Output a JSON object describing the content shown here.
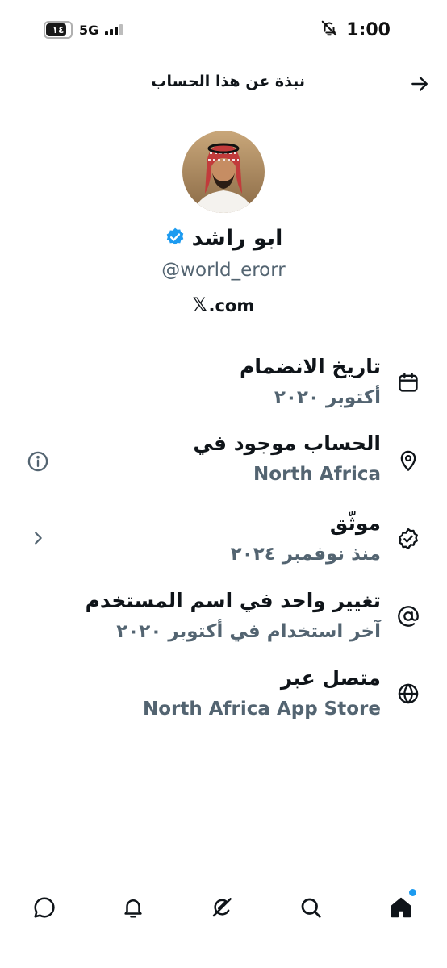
{
  "status_bar": {
    "battery_level": "١٤",
    "network": "5G",
    "time": "1:00"
  },
  "header": {
    "title": "نبذة عن هذا الحساب",
    "back_icon": "arrow-right-icon"
  },
  "profile": {
    "display_name": "ابو راشد",
    "verified_icon": "verified-badge-icon",
    "handle": "@world_erorr",
    "site_logo": "𝕏",
    "site_domain": ".com"
  },
  "info": {
    "joined": {
      "title": "تاريخ الانضمام",
      "value": "أكتوبر ٢٠٢٠",
      "icon": "calendar-icon"
    },
    "location": {
      "title": "الحساب موجود في",
      "value": "North Africa",
      "icon": "location-pin-icon",
      "side_icon": "info-circle-icon"
    },
    "verified": {
      "title": "موثّق",
      "value": "منذ نوفمبر ٢٠٢٤",
      "icon": "verified-check-icon",
      "side_icon": "chevron-left-icon"
    },
    "username_changes": {
      "title": "تغيير واحد في اسم المستخدم",
      "value": "آخر استخدام في أكتوبر ٢٠٢٠",
      "icon": "at-sign-icon"
    },
    "connected_via": {
      "title": "متصل عبر",
      "value": "North Africa App Store",
      "icon": "globe-icon"
    }
  },
  "bottom_nav": {
    "items": [
      "messages-icon",
      "notifications-icon",
      "grok-icon",
      "search-icon",
      "home-icon"
    ],
    "active": "home-icon",
    "accent": "#1d9bf0"
  },
  "colors": {
    "text_primary": "#0f1419",
    "text_secondary": "#536471",
    "verified": "#1d9bf0"
  }
}
